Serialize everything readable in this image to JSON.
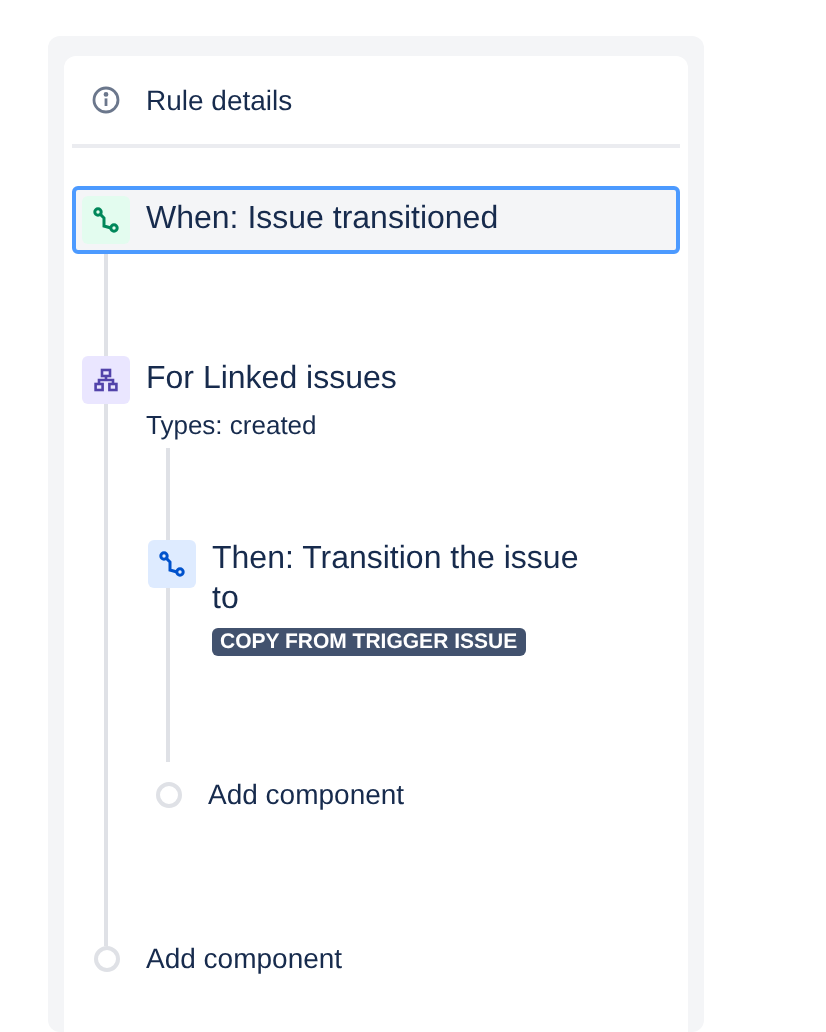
{
  "header": {
    "title": "Rule details"
  },
  "trigger": {
    "label": "When: Issue transitioned",
    "selected": true
  },
  "branch": {
    "title": "For Linked issues",
    "subtitle": "Types: created",
    "actions": [
      {
        "kind": "transition",
        "title": "Then: Transition the issue to",
        "lozenge": "COPY FROM TRIGGER ISSUE"
      }
    ],
    "add_label": "Add component"
  },
  "add_label": "Add component"
}
